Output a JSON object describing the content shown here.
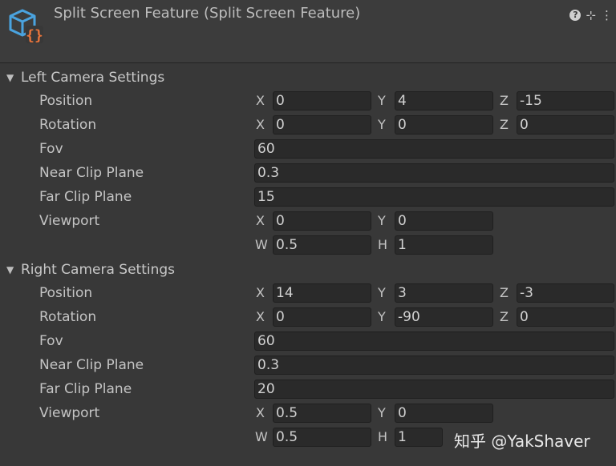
{
  "header": {
    "title": "Split Screen Feature (Split Screen Feature)",
    "icon": "script-component-icon",
    "buttons": [
      "help-icon",
      "presets-icon",
      "kebab-menu-icon"
    ]
  },
  "left": {
    "title": "Left Camera Settings",
    "position": {
      "label": "Position",
      "x": "0",
      "y": "4",
      "z": "-15"
    },
    "rotation": {
      "label": "Rotation",
      "x": "0",
      "y": "0",
      "z": "0"
    },
    "fov": {
      "label": "Fov",
      "value": "60"
    },
    "near": {
      "label": "Near Clip Plane",
      "value": "0.3"
    },
    "far": {
      "label": "Far Clip Plane",
      "value": "15"
    },
    "viewport": {
      "label": "Viewport",
      "x": "0",
      "y": "0",
      "w": "0.5",
      "h": "1"
    }
  },
  "right": {
    "title": "Right Camera Settings",
    "position": {
      "label": "Position",
      "x": "14",
      "y": "3",
      "z": "-3"
    },
    "rotation": {
      "label": "Rotation",
      "x": "0",
      "y": "-90",
      "z": "0"
    },
    "fov": {
      "label": "Fov",
      "value": "60"
    },
    "near": {
      "label": "Near Clip Plane",
      "value": "0.3"
    },
    "far": {
      "label": "Far Clip Plane",
      "value": "20"
    },
    "viewport": {
      "label": "Viewport",
      "x": "0.5",
      "y": "0",
      "w": "0.5",
      "h": "1"
    }
  },
  "axes": {
    "x": "X",
    "y": "Y",
    "z": "Z",
    "w": "W",
    "h": "H"
  },
  "watermark": "知乎 @YakShaver",
  "colors": {
    "background": "#383838",
    "field": "#2a2a2a",
    "icon_blue": "#4aa3df",
    "icon_orange": "#e8743b"
  }
}
